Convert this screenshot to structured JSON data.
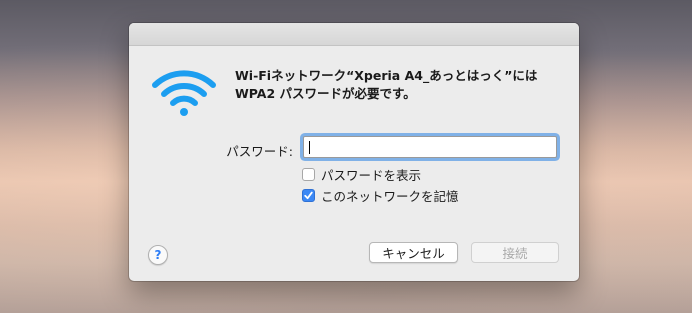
{
  "dialog": {
    "message": "Wi-Fiネットワーク“Xperia A4_あっとはっく”にはWPA2 パスワードが必要です。",
    "password_label": "パスワード:",
    "password_value": "",
    "show_password_label": "パスワードを表示",
    "show_password_checked": false,
    "remember_label": "このネットワークを記憶",
    "remember_checked": true,
    "help_label": "?",
    "cancel_label": "キャンセル",
    "connect_label": "接続",
    "connect_enabled": false
  },
  "icons": {
    "wifi": "wifi-icon",
    "checkmark": "checkmark-icon"
  },
  "colors": {
    "wifi_blue": "#1c9ef0",
    "focus_ring": "#5c9ee6",
    "checkbox_checked": "#3b88f5",
    "help_blue": "#2d7df6"
  }
}
